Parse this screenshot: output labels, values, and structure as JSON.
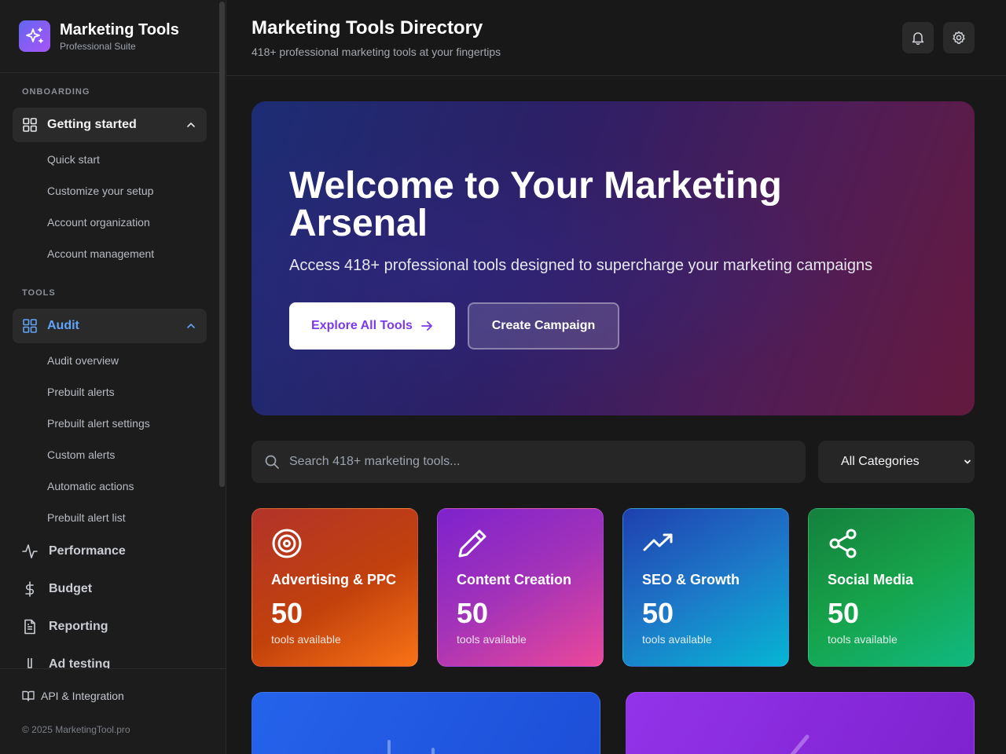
{
  "brand": {
    "title": "Marketing Tools",
    "subtitle": "Professional Suite"
  },
  "sidebar": {
    "onboarding_label": "ONBOARDING",
    "getting_started": {
      "label": "Getting started",
      "items": [
        "Quick start",
        "Customize your setup",
        "Account organization",
        "Account management"
      ]
    },
    "tools_label": "TOOLS",
    "audit": {
      "label": "Audit",
      "items": [
        "Audit overview",
        "Prebuilt alerts",
        "Prebuilt alert settings",
        "Custom alerts",
        "Automatic actions",
        "Prebuilt alert list"
      ]
    },
    "nav": [
      "Performance",
      "Budget",
      "Reporting",
      "Ad testing"
    ],
    "footer": {
      "api_label": "API & Integration",
      "copyright": "© 2025 MarketingTool.pro"
    }
  },
  "header": {
    "title": "Marketing Tools Directory",
    "subtitle": "418+ professional marketing tools at your fingertips",
    "icons": [
      "bell-icon",
      "gear-icon"
    ]
  },
  "hero": {
    "title": "Welcome to Your Marketing Arsenal",
    "subtitle": "Access 418+ professional tools designed to supercharge your marketing campaigns",
    "primary_button": "Explore All Tools",
    "secondary_button": "Create Campaign"
  },
  "search": {
    "placeholder": "Search 418+ marketing tools...",
    "category_selected": "All Categories"
  },
  "categories": [
    {
      "name": "Advertising & PPC",
      "count": "50",
      "unit": "tools available",
      "icon": "target-icon"
    },
    {
      "name": "Content Creation",
      "count": "50",
      "unit": "tools available",
      "icon": "pencil-icon"
    },
    {
      "name": "SEO & Growth",
      "count": "50",
      "unit": "tools available",
      "icon": "trending-up-icon"
    },
    {
      "name": "Social Media",
      "count": "50",
      "unit": "tools available",
      "icon": "share-icon"
    }
  ],
  "colors": {
    "accent": "#60a5fa",
    "primary_button_text": "#7c3aed"
  }
}
